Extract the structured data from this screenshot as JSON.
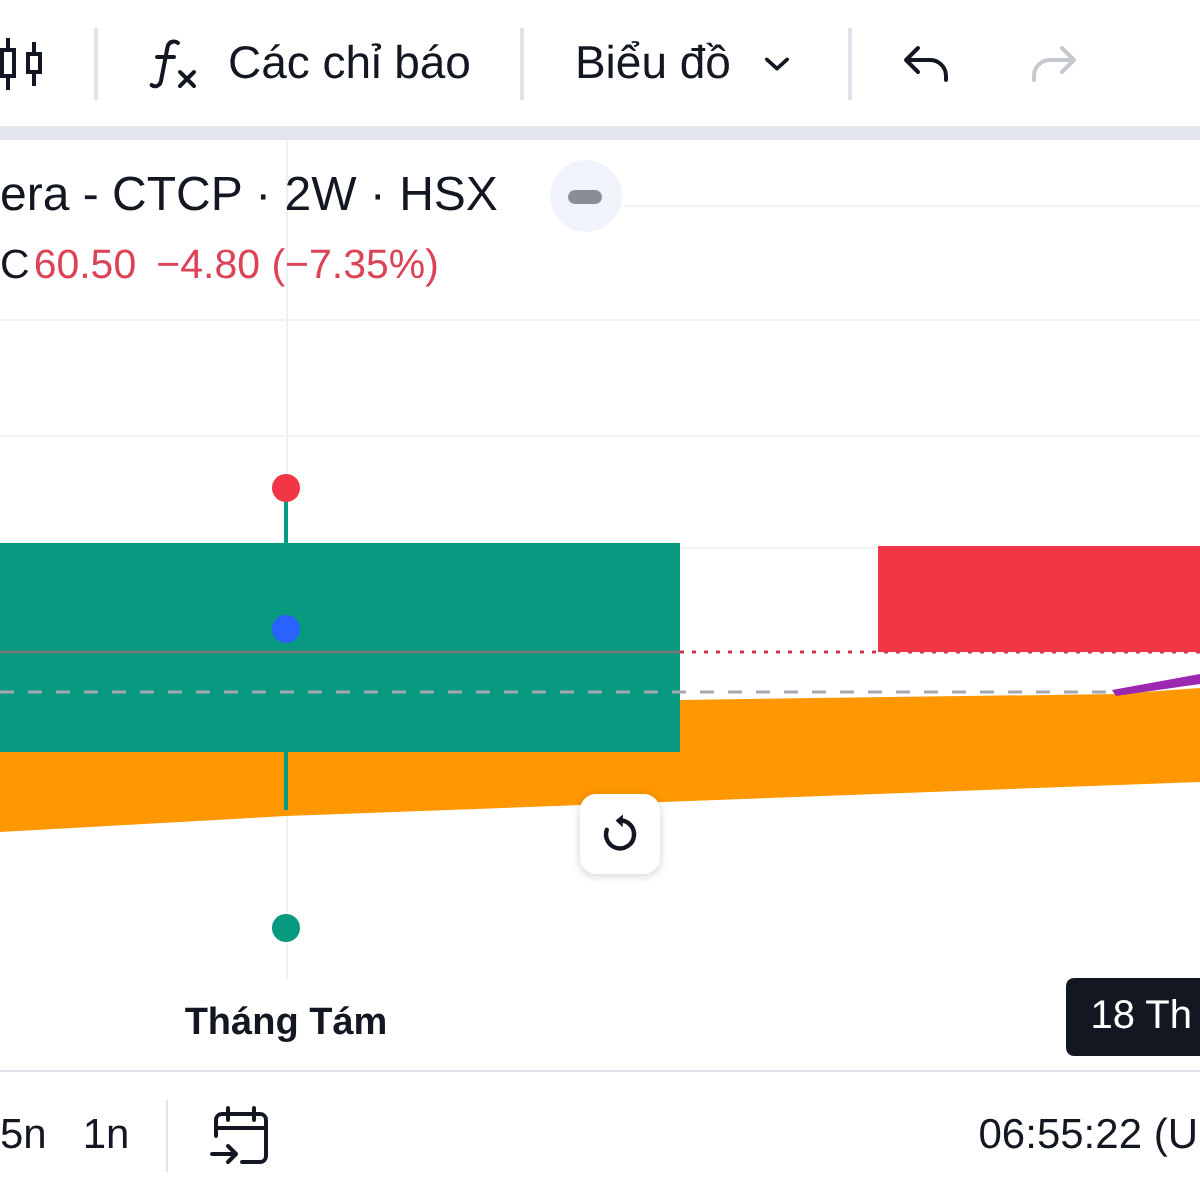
{
  "toolbar": {
    "groups": [
      [
        {
          "kind": "chart-style",
          "disabled": false
        }
      ],
      [
        {
          "kind": "indicators",
          "label": "Các chỉ báo",
          "disabled": false
        }
      ],
      [
        {
          "kind": "menu",
          "label": "Biểu đồ",
          "disabled": false
        }
      ],
      [
        {
          "kind": "undo",
          "disabled": false
        },
        {
          "kind": "redo",
          "disabled": true
        }
      ]
    ]
  },
  "legend": {
    "title": "era - CTCP · 2W · HSX",
    "close_label": "C",
    "close": "60.50",
    "change": "−4.80 (−7.35%)",
    "negative": true
  },
  "time_axis": {
    "labels": [
      "Tháng Tám"
    ],
    "cursor_label": "18 Th"
  },
  "bottom_bar": {
    "ranges": [
      {
        "label": "5n",
        "selected": false
      },
      {
        "label": "1n",
        "selected": false
      }
    ],
    "clock": "06:55:22 (U"
  }
}
